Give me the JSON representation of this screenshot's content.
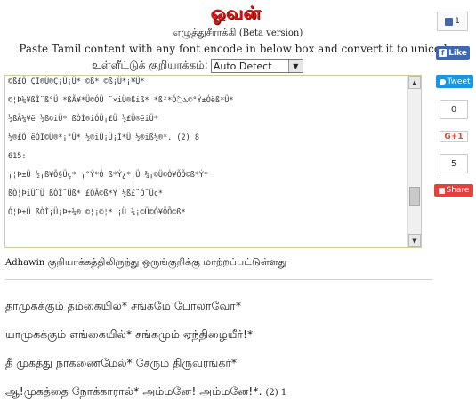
{
  "header": {
    "logo_text": "ஓவன்",
    "subtitle": "எழுத்துசீராக்கி",
    "subtitle_beta": "(Beta version)",
    "instruction": "Paste Tamil content with any font encode in below box and convert it to unicode.",
    "encode_label": "உள்ளீட்டுக் குறியாக்கம்:",
    "encode_selected": "Auto Detect"
  },
  "input_text": {
    "lines": [
      "©ß£Õ ÇI®Ù®Ç¡Ü¡Ü* ©ß* ©ß¡Ü*¡¥Ü*",
      "©¦Þ¼¥ßÌ¨ß°Ü *ßÃ¥*Ü©ÓÜ ¨×iÜ®ßiß* *ß²*Ó߮ܠ©°Ý±Óëß*Ü*",
      "½ßÃ¼¥ë ½ß©iÜ* ßÒÌ®iÓÜ¡£Ü ½£Ü®ëiÜ*",
      "½®£Ó ëÓÌ©Ü®*¡°Ü* ½®iÜ¡Ü¡Î*Ü ½®iß½®*. (2)  8",
      "615:",
      "¡¦Þ±Ü ½¡ß¥Õ§Üç* ¡°Ý*Ó ß*Ý¿*¡Ü ¾¡©Ü©Ó¥ÕÕ©ß*Ý*",
      "ßÒ¦ÞiÜ¨Ü ßÒÌ¨Üß* £ÓÃ©ß*Ý ½ß£¨Ó¨Üç*",
      "Ó¦Þ±Ü ßÒÌ¡Ü¡Þ±¼® ©¦¡©¦* ¡Ü ¾¡©Ü©Ó¥ÕÕ©ß*"
    ]
  },
  "status": {
    "font_name": "Adhawin",
    "message": "குறியாக்கத்திலிருந்து ஒருங்குறிக்கு மாற்றப்பட்டுள்ளது"
  },
  "output": {
    "lines": [
      "தாமுகக்கும் தம்கையில்* சங்கமே போலாவோ*",
      "யாமுகக்கும் எங்கையில்* சங்கமும் ஏந்திழையீர்!*",
      "தீ முகத்து நாகணைமேல்* சேரும் திருவரங்கர்*",
      "ஆ!முகத்தை நோக்காரால்* அம்மனே! அம்மனே!*."
    ],
    "last_line_suffix": "(2) 1"
  },
  "share": {
    "like_count": "1",
    "fb_like_label": "Like",
    "tweet_label": "Tweet",
    "share_count_top": "0",
    "gplus_label": "G+1",
    "share_count_bottom": "5",
    "share_label": "Share"
  },
  "colors": {
    "logo_red": "#d21a1a",
    "facebook_blue": "#4267b2",
    "twitter_blue": "#1b95e0",
    "share_red": "#e0423d",
    "textarea_border": "#cfcf94"
  }
}
